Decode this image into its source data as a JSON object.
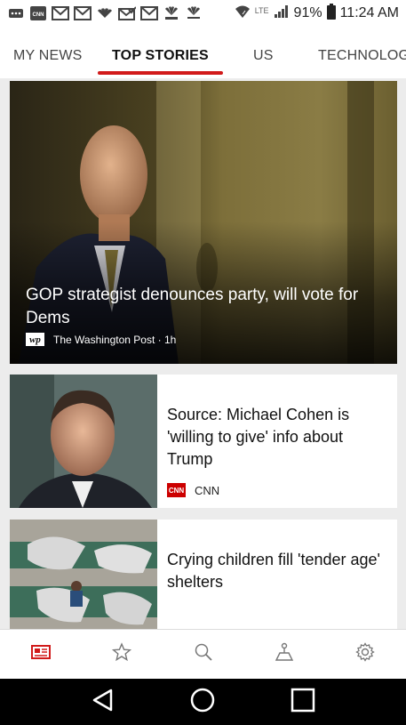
{
  "status_bar": {
    "notification_icons": [
      "chat-bubble-icon",
      "cnn-icon",
      "gmail-icon",
      "gmail-icon",
      "nbc-icon",
      "mail-check-icon",
      "gmail-icon",
      "nbc-news-icon",
      "cnbc-icon"
    ],
    "network_label": "LTE",
    "battery": "91%",
    "time": "11:24 AM"
  },
  "tabs": {
    "items": [
      "MY NEWS",
      "TOP STORIES",
      "US",
      "TECHNOLOGY"
    ],
    "active": "TOP STORIES",
    "accent_color": "#d11a1a"
  },
  "articles": [
    {
      "headline": "GOP strategist denounces party, will vote for Dems",
      "source_logo": "wp",
      "source": "The Washington Post · 1h"
    },
    {
      "headline": "Source: Michael Cohen is 'willing to give' info about Trump",
      "source_logo": "CNN",
      "source": "CNN"
    },
    {
      "headline": "Crying children fill 'tender age' shelters",
      "source": ""
    }
  ],
  "bottom_nav": [
    "news-icon",
    "star-icon",
    "search-icon",
    "local-news-icon",
    "settings-icon"
  ],
  "system_nav": [
    "back-icon",
    "home-icon",
    "recents-icon"
  ]
}
